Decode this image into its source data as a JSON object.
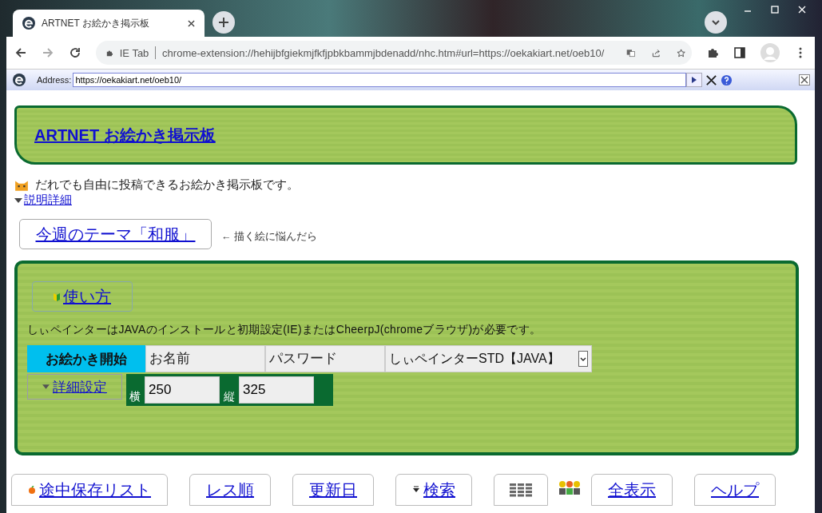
{
  "browser": {
    "tab_title": "ARTNET お絵かき掲示板",
    "site_chip": "IE Tab",
    "url": "chrome-extension://hehijbfgiekmjfkfjpbkbammjbdenadd/nhc.htm#url=https://oekakiart.net/oeb10/",
    "address_label": "Address:",
    "address_value": "https://oekakiart.net/oeb10/"
  },
  "header": {
    "title": "ARTNET お絵かき掲示板"
  },
  "intro": {
    "description": "だれでも自由に投稿できるお絵かき掲示板です。",
    "details_link": "説明詳細"
  },
  "theme": {
    "button": "今週のテーマ「和服」",
    "hint": "← 描く絵に悩んだら"
  },
  "panel": {
    "howto_button": "使い方",
    "notice": "しぃペインターはJAVAのインストールと初期設定(IE)またはCheerpJ(chromeブラウザ)が必要です。",
    "start_button": "お絵かき開始",
    "name_placeholder": "お名前",
    "password_placeholder": "パスワード",
    "painter_select": "しぃペインターSTD【JAVA】",
    "advanced_link": "詳細設定",
    "width_label": "横",
    "width_value": "250",
    "height_label": "縦",
    "height_value": "325"
  },
  "bottom_nav": [
    {
      "kind": "fruit",
      "label": "途中保存リスト"
    },
    {
      "kind": "plain",
      "label": "レス順"
    },
    {
      "kind": "plain",
      "label": "更新日"
    },
    {
      "kind": "caret",
      "label": "検索"
    },
    {
      "kind": "grid"
    },
    {
      "kind": "people"
    },
    {
      "kind": "plain",
      "label": "全表示"
    },
    {
      "kind": "plain",
      "label": "ヘルプ"
    }
  ]
}
